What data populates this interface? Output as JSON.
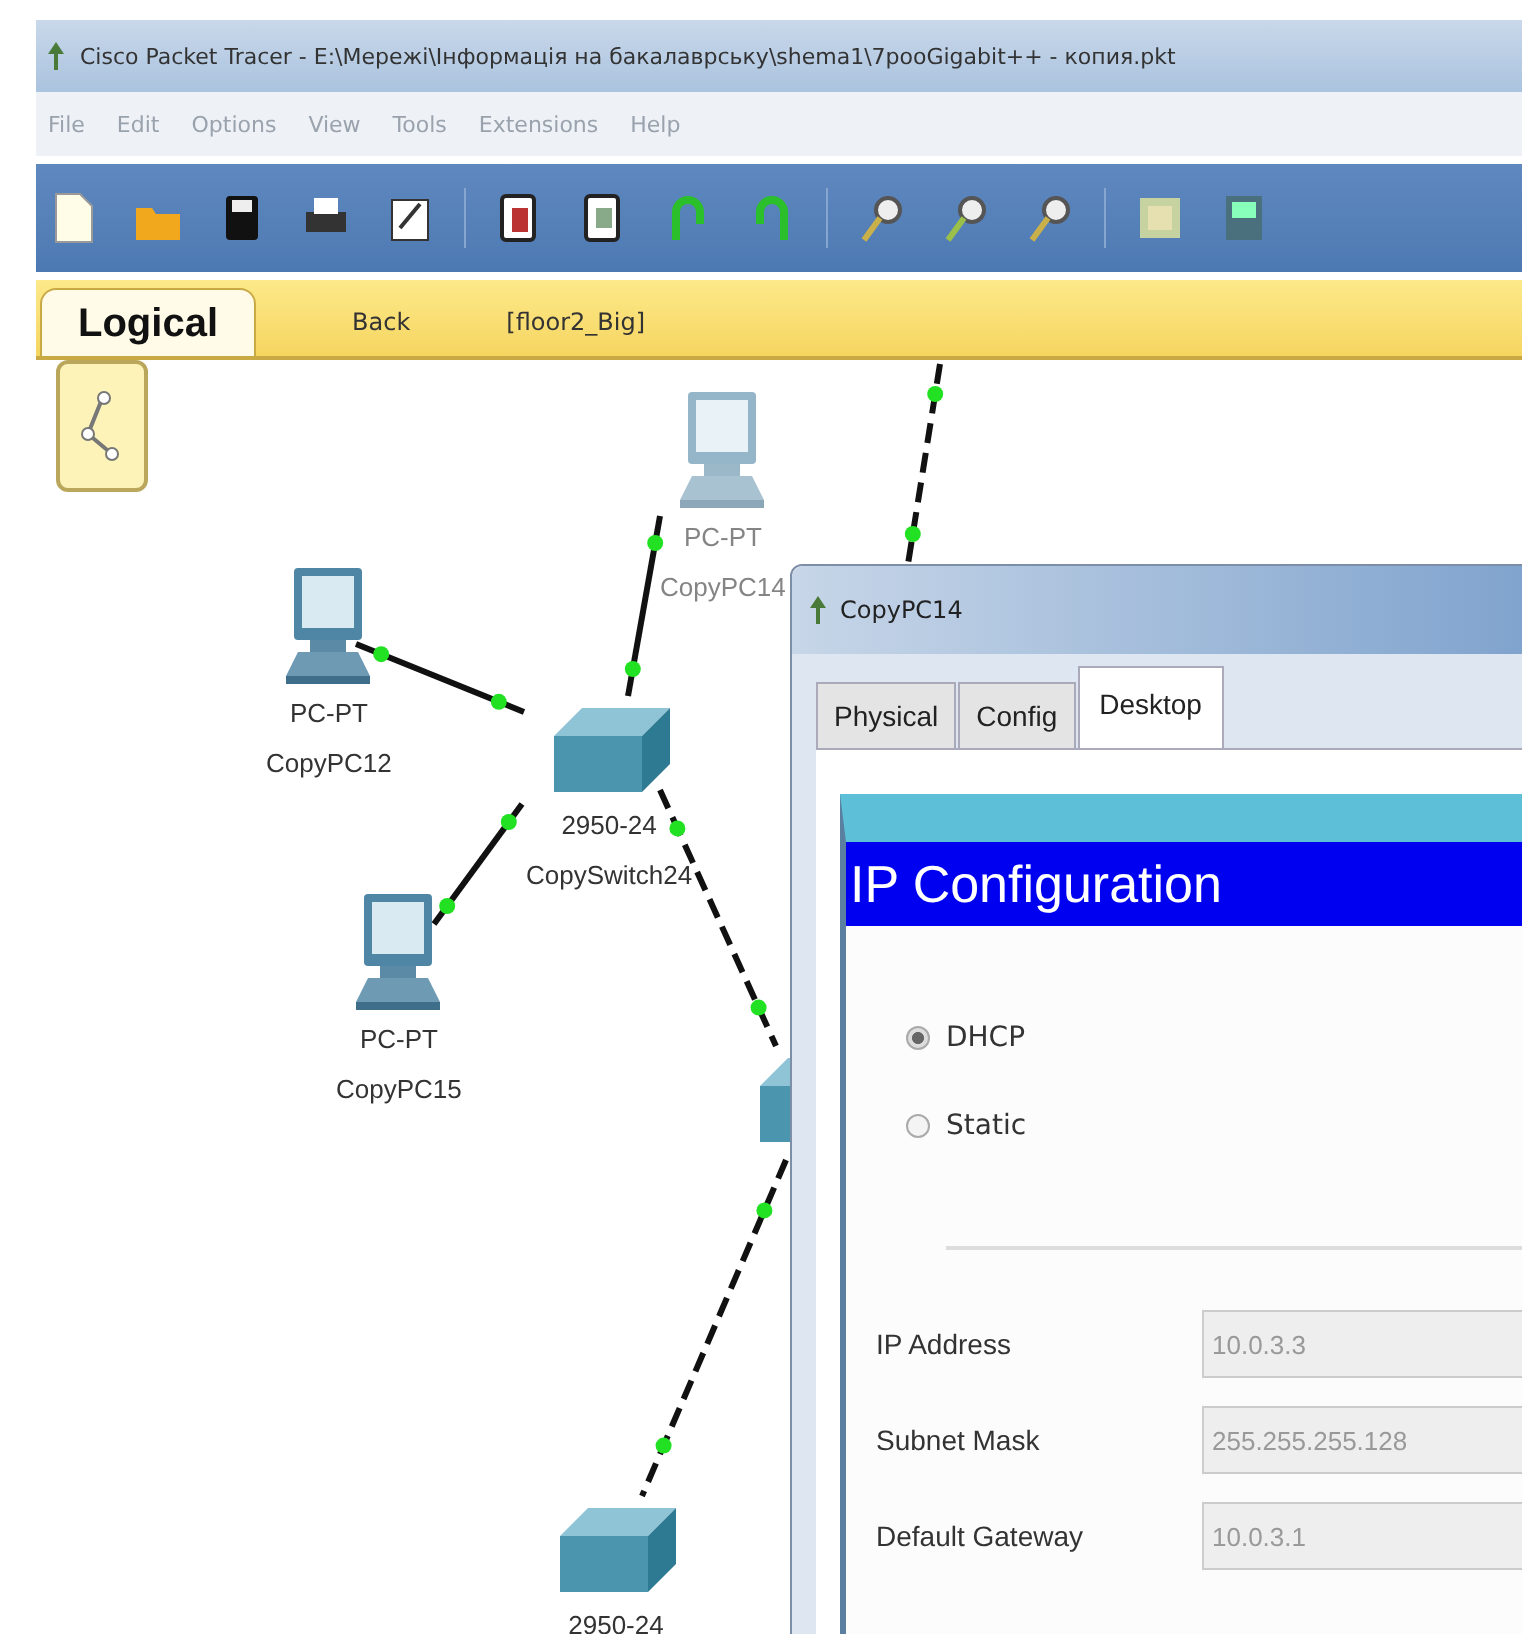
{
  "window": {
    "title": "Cisco Packet Tracer - E:\\Мережі\\Інформація на бакалаврську\\shema1\\7pooGigabit++ - копия.pkt"
  },
  "menu": [
    "File",
    "Edit",
    "Options",
    "View",
    "Tools",
    "Extensions",
    "Help"
  ],
  "workspace_bar": {
    "tabs": [
      {
        "label": "Logical",
        "selected": true
      }
    ],
    "back": "Back",
    "path": "[floor2_Big]"
  },
  "nodes": [
    {
      "kind": "pc",
      "labels": [
        "PC-PT",
        "CopyPC14"
      ]
    },
    {
      "kind": "pc",
      "labels": [
        "PC-PT",
        "CopyPC12"
      ]
    },
    {
      "kind": "switch",
      "labels": [
        "2950-24",
        "CopySwitch24"
      ]
    },
    {
      "kind": "pc",
      "labels": [
        "PC-PT",
        "CopyPC15"
      ]
    },
    {
      "kind": "switch"
    },
    {
      "kind": "switch",
      "labels": [
        "2950-24"
      ]
    }
  ],
  "links": [
    {
      "kind": "copper"
    },
    {
      "kind": "copper"
    },
    {
      "kind": "copper"
    },
    {
      "kind": "crossover"
    },
    {
      "kind": "crossover"
    },
    {
      "kind": "crossover"
    }
  ],
  "dialog": {
    "title": "CopyPC14",
    "tabs": [
      {
        "label": "Physical",
        "selected": false
      },
      {
        "label": "Config",
        "selected": false
      },
      {
        "label": "Desktop",
        "selected": true
      }
    ],
    "heading": "IP Configuration",
    "modes": [
      {
        "label": "DHCP",
        "selected": true
      },
      {
        "label": "Static",
        "selected": false
      }
    ],
    "fields": [
      {
        "label": "IP Address",
        "value": "10.0.3.3",
        "disabled": true
      },
      {
        "label": "Subnet Mask",
        "value": "255.255.255.128",
        "disabled": true
      },
      {
        "label": "Default Gateway",
        "value": "10.0.3.1",
        "disabled": true
      }
    ]
  }
}
